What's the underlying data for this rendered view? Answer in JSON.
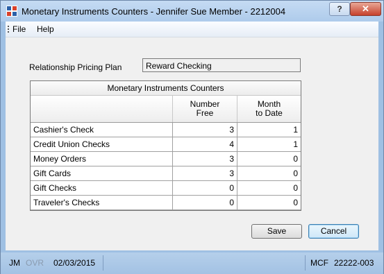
{
  "window": {
    "title": "Monetary Instruments Counters - Jennifer Sue Member - 2212004",
    "help_label": "?",
    "close_label": "✕"
  },
  "menu": {
    "file": "File",
    "help": "Help"
  },
  "plan": {
    "label": "Relationship Pricing Plan",
    "value": "Reward Checking"
  },
  "grid": {
    "caption": "Monetary Instruments Counters",
    "columns": [
      "",
      "Number\nFree",
      "Month\nto Date"
    ],
    "rows": [
      {
        "name": "Cashier's Check",
        "free": "3",
        "mtd": "1"
      },
      {
        "name": "Credit Union Checks",
        "free": "4",
        "mtd": "1"
      },
      {
        "name": "Money Orders",
        "free": "3",
        "mtd": "0"
      },
      {
        "name": "Gift Cards",
        "free": "3",
        "mtd": "0"
      },
      {
        "name": "Gift Checks",
        "free": "0",
        "mtd": "0"
      },
      {
        "name": "Traveler's Checks",
        "free": "0",
        "mtd": "0"
      }
    ]
  },
  "buttons": {
    "save": "Save",
    "cancel": "Cancel"
  },
  "status": {
    "user": "JM",
    "ovr": "OVR",
    "date": "02/03/2015",
    "app": "MCF",
    "code": "22222-003"
  },
  "colors": {
    "accent": "#3c7fb1",
    "frame": "#9fc0e3",
    "close": "#c6412c",
    "ovr_text": "#8a9bb0"
  }
}
